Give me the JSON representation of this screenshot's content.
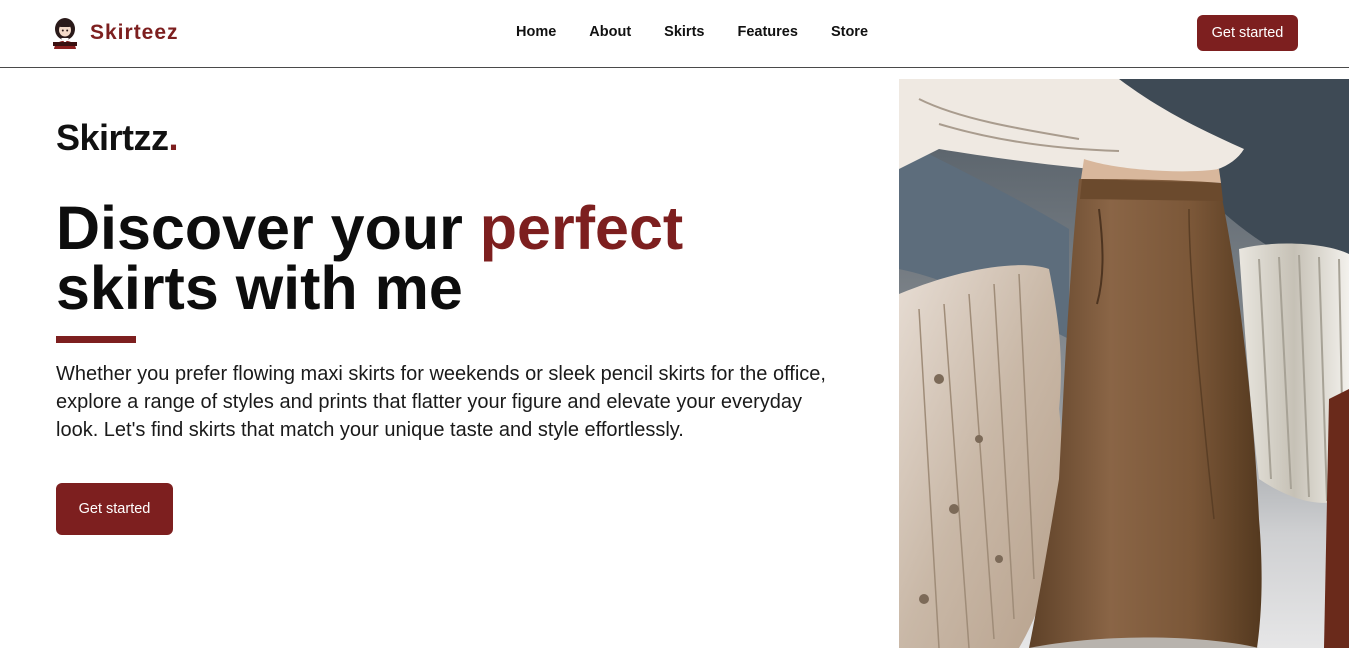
{
  "brand": {
    "name": "Skirteez",
    "logo_icon": "girl-avatar-icon"
  },
  "nav": {
    "links": [
      "Home",
      "About",
      "Skirts",
      "Features",
      "Store"
    ],
    "cta_label": "Get started"
  },
  "hero": {
    "brand_text": "Skirtzz",
    "brand_dot": ".",
    "title_part1": "Discover your ",
    "title_accent": "perfect",
    "title_part2": "skirts with me",
    "description": "Whether you prefer flowing maxi skirts for weekends or sleek pencil skirts for the office, explore a range of styles and prints that flatter your figure and elevate your everyday look. Let's find skirts that match your unique taste and style effortlessly.",
    "cta_label": "Get started",
    "image_icon": "skirts-photo"
  },
  "colors": {
    "accent": "#7d1f1f",
    "text": "#111111",
    "background": "#ffffff"
  }
}
